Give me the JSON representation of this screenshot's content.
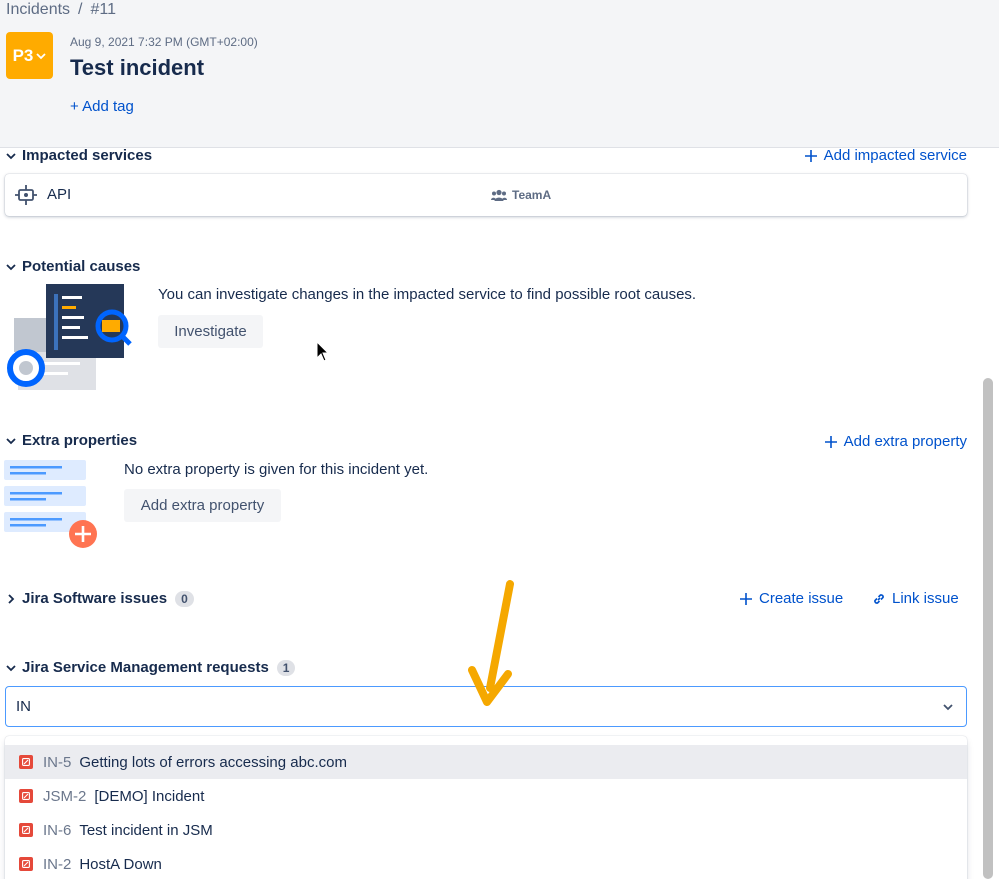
{
  "breadcrumb": {
    "parent": "Incidents",
    "separator": "/",
    "current": "#11"
  },
  "incident": {
    "priority": "P3",
    "priority_color": "#ffab00",
    "date": "Aug 9, 2021 7:32 PM (GMT+02:00)",
    "title": "Test incident",
    "add_tag_label": "+ Add tag"
  },
  "impacted_services": {
    "heading": "Impacted services",
    "action_label": "Add impacted service",
    "service": {
      "name": "API",
      "team": "TeamA"
    }
  },
  "potential_causes": {
    "heading": "Potential causes",
    "description": "You can investigate changes in the impacted service to find possible root causes.",
    "button_label": "Investigate"
  },
  "extra_properties": {
    "heading": "Extra properties",
    "action_label": "Add extra property",
    "empty_text": "No extra property is given for this incident yet.",
    "button_label": "Add extra property"
  },
  "jira_software": {
    "heading": "Jira Software issues",
    "count": "0",
    "create_label": "Create issue",
    "link_label": "Link issue"
  },
  "jsm_requests": {
    "heading": "Jira Service Management requests",
    "count": "1",
    "select_value": "IN",
    "options": [
      {
        "key": "IN-5",
        "summary": "Getting lots of errors accessing abc.com"
      },
      {
        "key": "JSM-2",
        "summary": "[DEMO] Incident"
      },
      {
        "key": "IN-6",
        "summary": "Test incident in JSM"
      },
      {
        "key": "IN-2",
        "summary": "HostA Down"
      }
    ]
  },
  "colors": {
    "link": "#0052cc",
    "text": "#172b4d",
    "issue_icon": "#e5493a",
    "annotation_arrow": "#f5a800"
  }
}
